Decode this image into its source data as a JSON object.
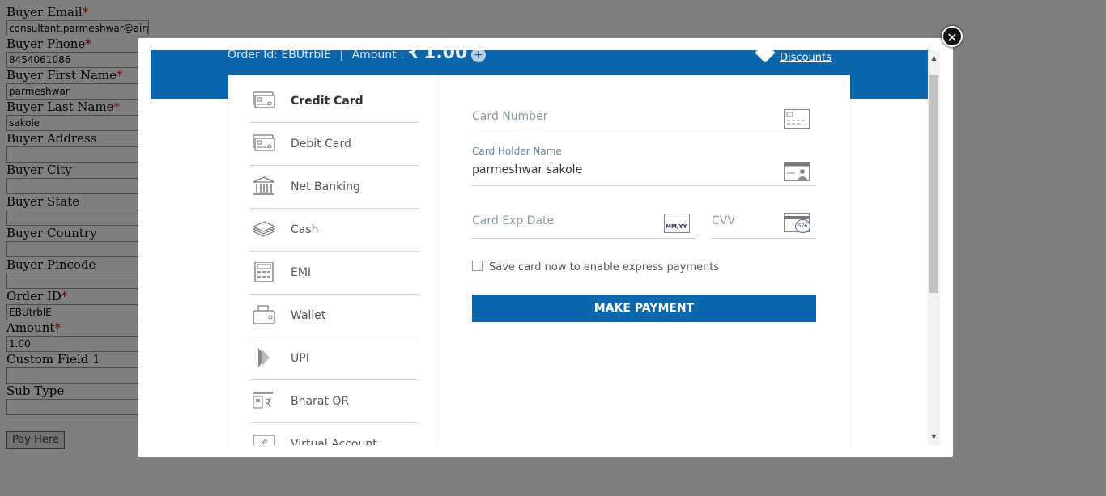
{
  "background_form": {
    "fields": [
      {
        "label": "Buyer Email",
        "required": "*",
        "value": "consultant.parmeshwar@airpay"
      },
      {
        "label": "Buyer Phone",
        "required": "*",
        "value": "8454061086"
      },
      {
        "label": "Buyer First Name",
        "required": "*",
        "value": "parmeshwar"
      },
      {
        "label": "Buyer Last Name",
        "required": "*",
        "value": "sakole"
      },
      {
        "label": "Buyer Address",
        "required": "",
        "value": ""
      },
      {
        "label": "Buyer City",
        "required": "",
        "value": ""
      },
      {
        "label": "Buyer State",
        "required": "",
        "value": ""
      },
      {
        "label": "Buyer Country",
        "required": "",
        "value": ""
      },
      {
        "label": "Buyer Pincode",
        "required": "",
        "value": ""
      },
      {
        "label": "Order ID",
        "required": "*",
        "value": "EBUtrblE"
      },
      {
        "label": "Amount",
        "required": "*",
        "value": "1.00"
      },
      {
        "label": "Custom Field 1",
        "required": "",
        "value": ""
      },
      {
        "label": "Sub Type",
        "required": "",
        "value": ""
      }
    ],
    "pay_button": "Pay Here"
  },
  "modal": {
    "close_glyph": "✕",
    "header": {
      "order_text": "Order Id: EBUtrblE",
      "separator": "|",
      "amount_label": "Amount :",
      "currency_symbol": "₹",
      "amount_value": "1.00",
      "plus_glyph": "+",
      "discounts_label": "Discounts"
    },
    "methods": [
      {
        "label": "Credit Card",
        "icon": "credit-card-icon",
        "active": true
      },
      {
        "label": "Debit Card",
        "icon": "debit-card-icon",
        "active": false
      },
      {
        "label": "Net Banking",
        "icon": "bank-icon",
        "active": false
      },
      {
        "label": "Cash",
        "icon": "cash-icon",
        "active": false
      },
      {
        "label": "EMI",
        "icon": "calculator-icon",
        "active": false
      },
      {
        "label": "Wallet",
        "icon": "wallet-icon",
        "active": false
      },
      {
        "label": "UPI",
        "icon": "upi-icon",
        "active": false
      },
      {
        "label": "Bharat QR",
        "icon": "bharat-qr-icon",
        "active": false
      },
      {
        "label": "Virtual Account",
        "icon": "virtual-account-icon",
        "active": false
      }
    ],
    "form": {
      "card_number_placeholder": "Card Number",
      "card_holder_label": "Card Holder Name",
      "card_holder_value": "parmeshwar sakole",
      "exp_placeholder": "Card Exp Date",
      "exp_icon_text": "MM/YY",
      "cvv_placeholder": "CVV",
      "cvv_icon_text": "576",
      "save_card_label": "Save card now to enable express payments",
      "submit_label": "MAKE PAYMENT"
    }
  },
  "colors": {
    "primary": "#0c66ab",
    "overlay": "rgba(0,0,0,0.5)"
  }
}
